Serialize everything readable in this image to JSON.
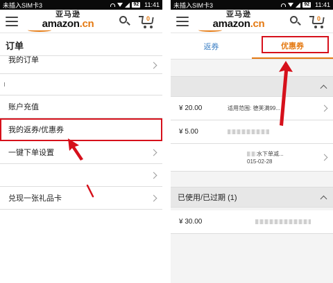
{
  "status": {
    "carrier": "未插入SIM卡3",
    "battery": "92",
    "time": "11:41"
  },
  "logo": {
    "cn": "亚马逊",
    "en": "amazon",
    "tld": ".cn"
  },
  "cart": {
    "count": "0"
  },
  "left": {
    "section_title": "订单",
    "first_item": "我的订单",
    "items": [
      {
        "label": "账户充值"
      },
      {
        "label": "我的返券/优惠券"
      },
      {
        "label": "一键下单设置"
      },
      {
        "label": ""
      },
      {
        "label": "兑现一张礼品卡"
      }
    ]
  },
  "right": {
    "tabs": [
      {
        "label": "返券"
      },
      {
        "label": "优惠券"
      }
    ],
    "active_coupons": [
      {
        "amount": "¥ 20.00",
        "desc": "适用范围: 德芙满99..."
      },
      {
        "amount": "¥ 5.00",
        "desc": ""
      },
      {
        "amount": "",
        "desc": "水下单减...",
        "desc2": "015-02-28"
      }
    ],
    "used_expired_label": "已使用/已过期 (1)",
    "used_coupons": [
      {
        "amount": "¥ 30.00"
      }
    ]
  },
  "colors": {
    "accent": "#e47911",
    "highlight": "#d6101b",
    "link": "#3b7fc4"
  }
}
